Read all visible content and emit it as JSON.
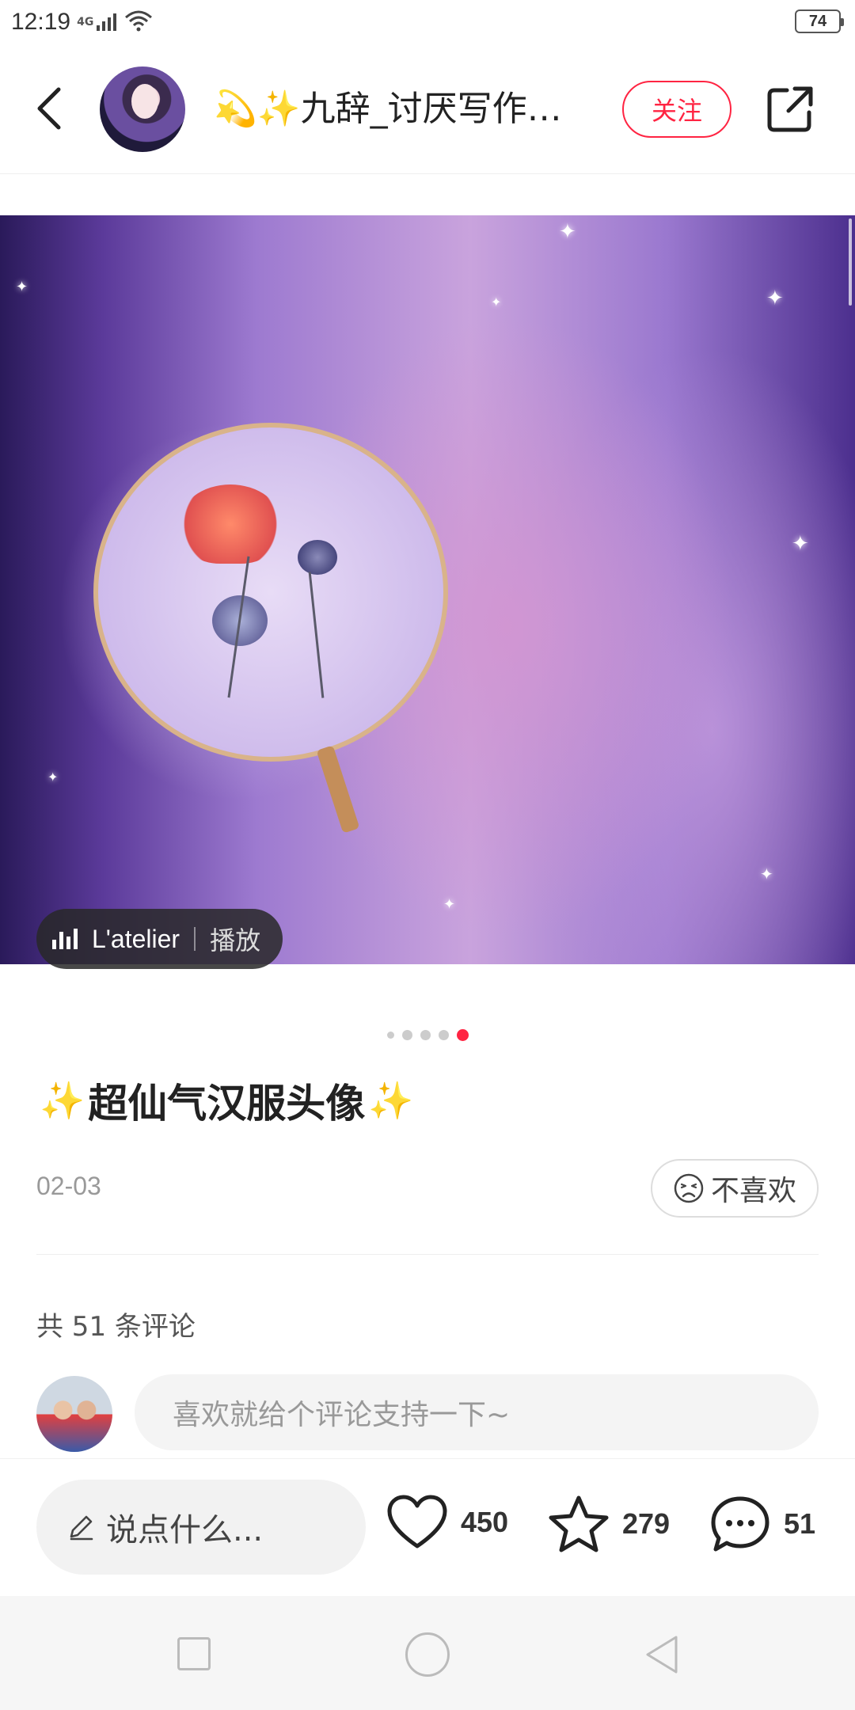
{
  "status_bar": {
    "time": "12:19",
    "network": "4G",
    "battery": "74"
  },
  "header": {
    "username": "💫✨九辞_讨厌写作…",
    "follow_label": "关注",
    "back_icon": "chevron-left-icon",
    "share_icon": "share-external-icon"
  },
  "media": {
    "music_title": "L'atelier",
    "play_label": "播放",
    "page_count": 5,
    "active_page": 5
  },
  "post": {
    "title": "超仙气汉服头像",
    "title_emoji": "✨",
    "date": "02-03",
    "dislike_label": "不喜欢"
  },
  "comments": {
    "count_text": "共 51 条评论",
    "input_placeholder": "喜欢就给个评论支持一下~"
  },
  "action_bar": {
    "say_placeholder": "说点什么...",
    "likes": "450",
    "favorites": "279",
    "comments": "51"
  },
  "colors": {
    "accent": "#ff2442",
    "text": "#222222",
    "muted": "#999999"
  }
}
